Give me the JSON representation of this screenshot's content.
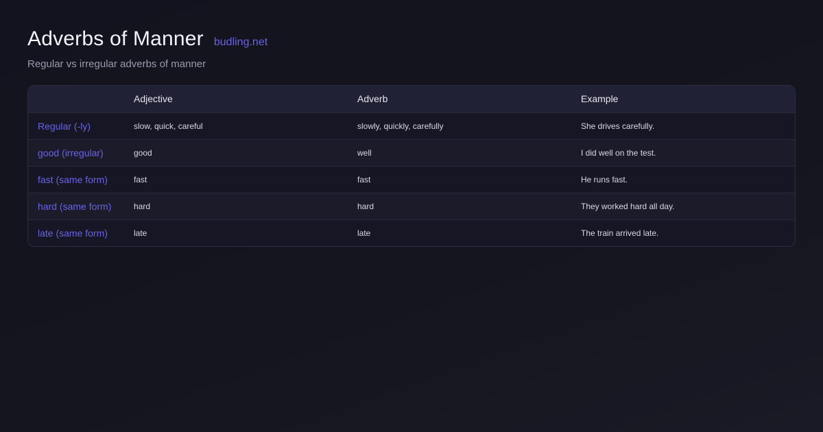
{
  "header": {
    "title": "Adverbs of Manner",
    "brand": "budling.net",
    "subtitle": "Regular vs irregular adverbs of manner"
  },
  "table": {
    "columns": [
      "",
      "Adjective",
      "Adverb",
      "Example"
    ],
    "rows": [
      {
        "label": "Regular (-ly)",
        "adjective": "slow, quick, careful",
        "adverb": "slowly, quickly, carefully",
        "example": "She drives carefully."
      },
      {
        "label": "good (irregular)",
        "adjective": "good",
        "adverb": "well",
        "example": "I did well on the test."
      },
      {
        "label": "fast (same form)",
        "adjective": "fast",
        "adverb": "fast",
        "example": "He runs fast."
      },
      {
        "label": "hard (same form)",
        "adjective": "hard",
        "adverb": "hard",
        "example": "They worked hard all day."
      },
      {
        "label": "late (same form)",
        "adjective": "late",
        "adverb": "late",
        "example": "The train arrived late."
      }
    ]
  },
  "colors": {
    "accent": "#6a63e6",
    "background": "#15151f",
    "header_row": "#212136"
  }
}
